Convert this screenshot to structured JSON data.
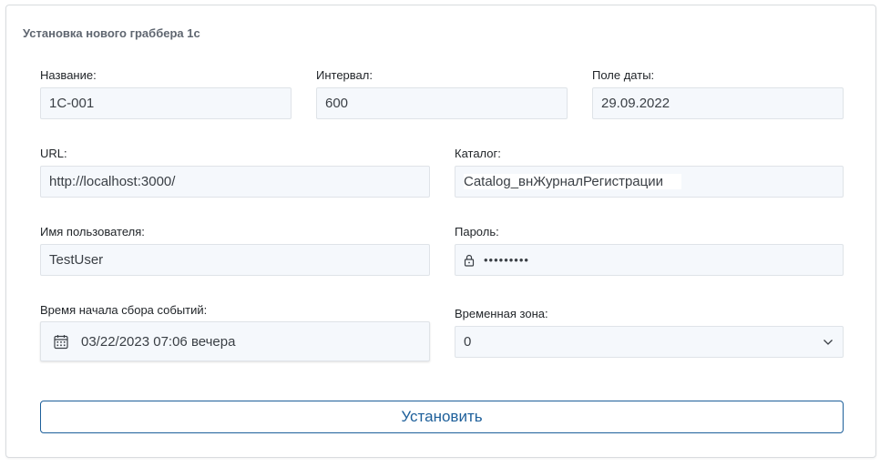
{
  "card": {
    "title": "Установка нового граббера 1с"
  },
  "fields": {
    "name": {
      "label": "Название:",
      "value": "1С-001"
    },
    "interval": {
      "label": "Интервал:",
      "value": "600"
    },
    "date_field": {
      "label": "Поле даты:",
      "value": "29.09.2022"
    },
    "url": {
      "label": "URL:",
      "value": "http://localhost:3000/"
    },
    "catalog": {
      "label": "Каталог:",
      "value": "Catalog_внЖурналРегистрации"
    },
    "username": {
      "label": "Имя пользователя:",
      "value": "TestUser"
    },
    "password": {
      "label": "Пароль:",
      "value": "•••••••••",
      "icon": "lock-icon"
    },
    "start_time": {
      "label": "Время начала сбора событий:",
      "value": "03/22/2023 07:06 вечера",
      "icon": "calendar-icon"
    },
    "timezone": {
      "label": "Временная зона:",
      "value": "0",
      "icon": "chevron-down-icon"
    }
  },
  "actions": {
    "submit_label": "Установить"
  },
  "colors": {
    "accent": "#1d5f9a",
    "field_bg": "#f5f8fc",
    "border": "#dfe3e8"
  }
}
